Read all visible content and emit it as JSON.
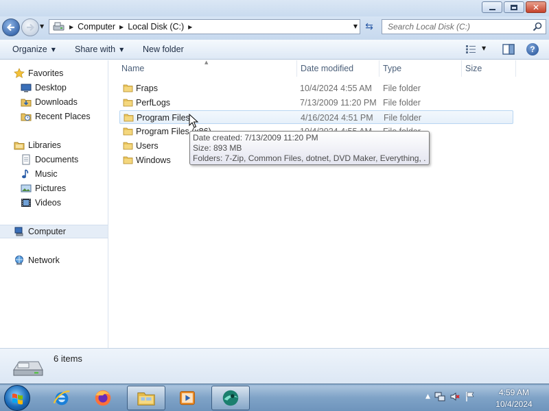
{
  "window": {
    "minimize_icon": "minimize-icon",
    "maximize_icon": "restore-icon",
    "close_icon": "close-icon"
  },
  "address": {
    "crumbs": [
      "Computer",
      "Local Disk (C:)"
    ],
    "search_placeholder": "Search Local Disk (C:)"
  },
  "toolbar": {
    "organize": "Organize",
    "share_with": "Share with",
    "new_folder": "New folder"
  },
  "nav": {
    "favorites": "Favorites",
    "desktop": "Desktop",
    "downloads": "Downloads",
    "recent_places": "Recent Places",
    "libraries": "Libraries",
    "documents": "Documents",
    "music": "Music",
    "pictures": "Pictures",
    "videos": "Videos",
    "computer": "Computer",
    "network": "Network"
  },
  "columns": {
    "name": "Name",
    "date_modified": "Date modified",
    "type": "Type",
    "size": "Size"
  },
  "files": [
    {
      "name": "Fraps",
      "date": "10/4/2024 4:55 AM",
      "type": "File folder"
    },
    {
      "name": "PerfLogs",
      "date": "7/13/2009 11:20 PM",
      "type": "File folder"
    },
    {
      "name": "Program Files",
      "date": "4/16/2024 4:51 PM",
      "type": "File folder"
    },
    {
      "name": "Program Files (x86)",
      "date": "10/4/2024 4:55 AM",
      "type": "File folder"
    },
    {
      "name": "Users",
      "date": "",
      "type": ""
    },
    {
      "name": "Windows",
      "date": "",
      "type": ""
    }
  ],
  "tooltip": {
    "created": "Date created: 7/13/2009 11:20 PM",
    "size": "Size: 893 MB",
    "folders": "Folders: 7-Zip, Common Files, dotnet, DVD Maker, Everything, ..."
  },
  "status": {
    "item_count": "6 items"
  },
  "taskbar": {
    "time": "4:59 AM",
    "date": "10/4/2024"
  },
  "colors": {
    "accent": "#1f4f9a",
    "selection": "#e5edf7",
    "taskbar": "#7fa3c7"
  }
}
